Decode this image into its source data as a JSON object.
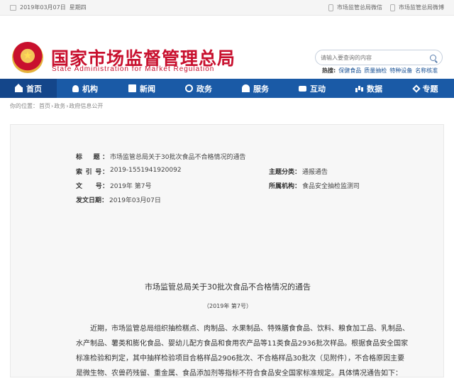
{
  "topbar": {
    "date": "2019年03月07日",
    "weekday": "星期四",
    "weixin": "市场监管总局微信",
    "weibo": "市场监管总局微博"
  },
  "header": {
    "title": "国家市场监督管理总局",
    "subtitle": "State Administration for Market Regulation",
    "search_placeholder": "请输入要查询的内容",
    "hot_label": "热搜:",
    "hot_items": [
      "保健食品",
      "质量抽检",
      "特种设备",
      "名称核准"
    ]
  },
  "nav": [
    {
      "label": "首页",
      "icon": "home-icon",
      "active": true
    },
    {
      "label": "机构",
      "icon": "people-icon"
    },
    {
      "label": "新闻",
      "icon": "news-icon"
    },
    {
      "label": "政务",
      "icon": "gov-icon"
    },
    {
      "label": "服务",
      "icon": "service-icon"
    },
    {
      "label": "互动",
      "icon": "chat-icon"
    },
    {
      "label": "数据",
      "icon": "chart-icon"
    },
    {
      "label": "专题",
      "icon": "topic-icon"
    }
  ],
  "breadcrumb": {
    "prefix": "你的位置：",
    "items": [
      "首页",
      "政务",
      "政府信息公开"
    ]
  },
  "meta": {
    "title_key": "标　题：",
    "title_val": "市场监管总局关于30批次食品不合格情况的通告",
    "index_key": "索 引 号：",
    "index_val": "2019-1551941920092",
    "category_key": "主题分类：",
    "category_val": "通报通告",
    "docno_key": "文　　号：",
    "docno_val": "2019年 第7号",
    "org_key": "所属机构：",
    "org_val": "食品安全抽检监测司",
    "date_key": "发文日期：",
    "date_val": "2019年03月07日"
  },
  "doc": {
    "title": "市场监管总局关于30批次食品不合格情况的通告",
    "number": "（2019年 第7号）",
    "body": "近期，市场监管总局组织抽检糕点、肉制品、水果制品、特殊膳食食品、饮料、粮食加工品、乳制品、水产制品、薯类和膨化食品、婴幼儿配方食品和食用农产品等11类食品2936批次样品。根据食品安全国家标准检验和判定，其中抽样检验项目合格样品2906批次、不合格样品30批次（见附件），不合格原因主要是微生物、农兽药残留、重金属、食品添加剂等指标不符合食品安全国家标准规定。具体情况通告如下："
  },
  "colors": {
    "brand_red": "#c8102e",
    "nav_blue": "#1a5aa6",
    "nav_active": "#14468a"
  }
}
